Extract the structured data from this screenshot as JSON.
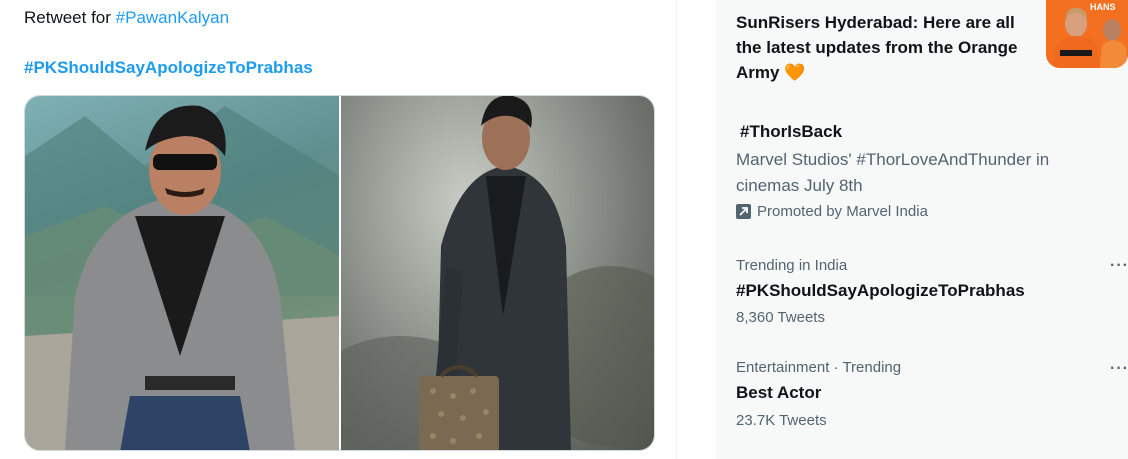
{
  "tweet": {
    "line1_prefix": "Retweet for ",
    "line1_hashtag": "#PawanKalyan",
    "line2_hashtag": "#PKShouldSayApologizeToPrabhas",
    "media": [
      {
        "name": "man-in-grey-blazer-sunglasses-photo"
      },
      {
        "name": "man-in-suit-with-briefcase-photo"
      }
    ]
  },
  "sidebar": {
    "news": {
      "title": "SunRisers Hyderabad: Here are all the latest updates from the Orange Army 🧡",
      "thumb_icon": "team-photo-thumbnail"
    },
    "trends": [
      {
        "name": "#ThorIsBack",
        "description": "Marvel Studios' #ThorLoveAndThunder in cinemas July 8th",
        "promoted": "Promoted by Marvel India",
        "promoted_icon": "promoted-arrow-icon"
      },
      {
        "context": "Trending in India",
        "name": "#PKShouldSayApologizeToPrabhas",
        "count": "8,360 Tweets",
        "more": "···"
      },
      {
        "context": "Entertainment · Trending",
        "name": "Best Actor",
        "count": "23.7K Tweets",
        "more": "···"
      }
    ]
  },
  "colors": {
    "link": "#1d9bf0",
    "text_primary": "#0f1419",
    "text_secondary": "#536471",
    "sidebar_bg": "#f7f9f9",
    "orange_army": "#f26522"
  }
}
